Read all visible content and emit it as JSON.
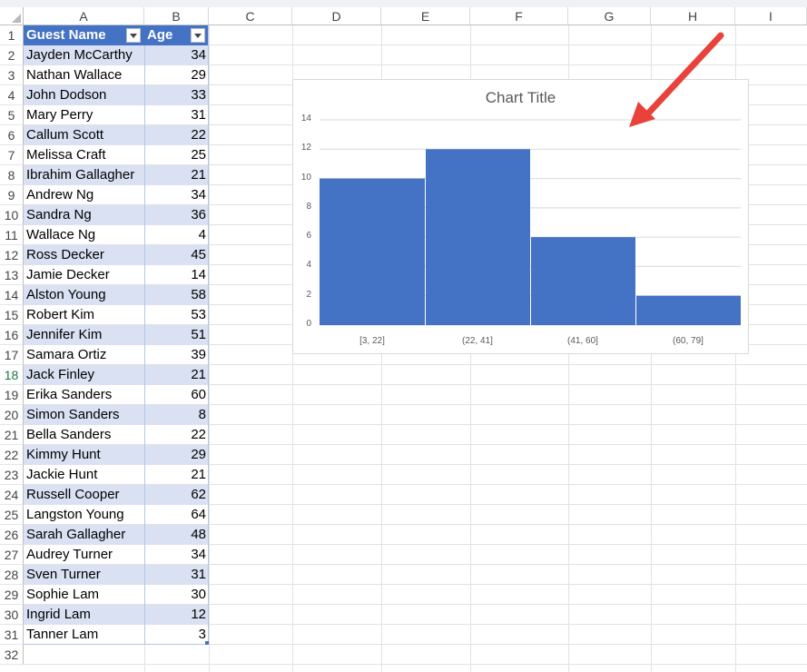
{
  "columns": [
    "A",
    "B",
    "C",
    "D",
    "E",
    "F",
    "G",
    "H",
    "I"
  ],
  "rows": [
    "1",
    "2",
    "3",
    "4",
    "5",
    "6",
    "7",
    "8",
    "9",
    "10",
    "11",
    "12",
    "13",
    "14",
    "15",
    "16",
    "17",
    "18",
    "19",
    "20",
    "21",
    "22",
    "23",
    "24",
    "25",
    "26",
    "27",
    "28",
    "29",
    "30",
    "31",
    "32"
  ],
  "active_row": "18",
  "table": {
    "headers": [
      "Guest Name",
      "Age"
    ],
    "records": [
      {
        "name": "Jayden McCarthy",
        "age": "34"
      },
      {
        "name": "Nathan Wallace",
        "age": "29"
      },
      {
        "name": "John Dodson",
        "age": "33"
      },
      {
        "name": "Mary Perry",
        "age": "31"
      },
      {
        "name": "Callum Scott",
        "age": "22"
      },
      {
        "name": "Melissa Craft",
        "age": "25"
      },
      {
        "name": "Ibrahim Gallagher",
        "age": "21"
      },
      {
        "name": "Andrew Ng",
        "age": "34"
      },
      {
        "name": "Sandra Ng",
        "age": "36"
      },
      {
        "name": "Wallace Ng",
        "age": "4"
      },
      {
        "name": "Ross Decker",
        "age": "45"
      },
      {
        "name": "Jamie Decker",
        "age": "14"
      },
      {
        "name": "Alston Young",
        "age": "58"
      },
      {
        "name": "Robert Kim",
        "age": "53"
      },
      {
        "name": "Jennifer Kim",
        "age": "51"
      },
      {
        "name": "Samara Ortiz",
        "age": "39"
      },
      {
        "name": "Jack Finley",
        "age": "21"
      },
      {
        "name": "Erika Sanders",
        "age": "60"
      },
      {
        "name": "Simon Sanders",
        "age": "8"
      },
      {
        "name": "Bella Sanders",
        "age": "22"
      },
      {
        "name": "Kimmy Hunt",
        "age": "29"
      },
      {
        "name": "Jackie Hunt",
        "age": "21"
      },
      {
        "name": "Russell Cooper",
        "age": "62"
      },
      {
        "name": "Langston Young",
        "age": "64"
      },
      {
        "name": "Sarah Gallagher",
        "age": "48"
      },
      {
        "name": "Audrey Turner",
        "age": "34"
      },
      {
        "name": "Sven Turner",
        "age": "31"
      },
      {
        "name": "Sophie Lam",
        "age": "30"
      },
      {
        "name": "Ingrid Lam",
        "age": "12"
      },
      {
        "name": "Tanner Lam",
        "age": "3"
      }
    ]
  },
  "colors": {
    "table_header": "#4472c4",
    "band": "#d9e1f2",
    "bar": "#4472c4",
    "arrow": "#e8423a"
  },
  "chart_data": {
    "type": "bar",
    "title": "Chart Title",
    "categories": [
      "[3, 22]",
      "(22, 41]",
      "(41, 60]",
      "(60, 79]"
    ],
    "values": [
      10,
      12,
      6,
      2
    ],
    "ylim": [
      0,
      14
    ],
    "yticks": [
      "0",
      "2",
      "4",
      "6",
      "8",
      "10",
      "12",
      "14"
    ],
    "grid": true
  }
}
